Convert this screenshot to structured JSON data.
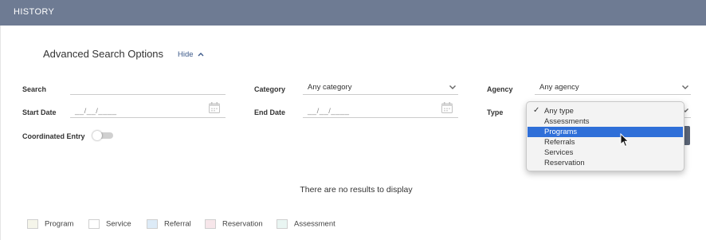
{
  "header": {
    "title": "HISTORY"
  },
  "advanced": {
    "title": "Advanced Search Options",
    "hide_label": "Hide"
  },
  "labels": {
    "search": "Search",
    "start_date": "Start Date",
    "coordinated_entry": "Coordinated Entry",
    "category": "Category",
    "end_date": "End Date",
    "agency": "Agency",
    "type": "Type"
  },
  "fields": {
    "search_value": "",
    "start_date_placeholder": "__/__/____",
    "end_date_placeholder": "__/__/____",
    "category_value": "Any category",
    "agency_value": "Any agency"
  },
  "toggle": {
    "coordinated_entry_on": false
  },
  "type_dropdown": {
    "options": [
      "Any type",
      "Assessments",
      "Programs",
      "Referrals",
      "Services",
      "Reservation"
    ],
    "checked": "Any type",
    "highlighted": "Programs"
  },
  "results": {
    "empty_message": "There are no results to display"
  },
  "legend": [
    {
      "label": "Program",
      "color": "#f5f5ea"
    },
    {
      "label": "Service",
      "color": "#ffffff"
    },
    {
      "label": "Referral",
      "color": "#ddebf7"
    },
    {
      "label": "Reservation",
      "color": "#f7e6ea"
    },
    {
      "label": "Assessment",
      "color": "#e9f5f2"
    }
  ],
  "colors": {
    "header_bg": "#6e7b93",
    "link": "#3d5a8a",
    "selection": "#2f6fd8"
  },
  "icons": {
    "calendar": "calendar-icon",
    "caret": "chevron-down-icon",
    "hide": "chevron-up-icon",
    "check": "checkmark-icon"
  }
}
